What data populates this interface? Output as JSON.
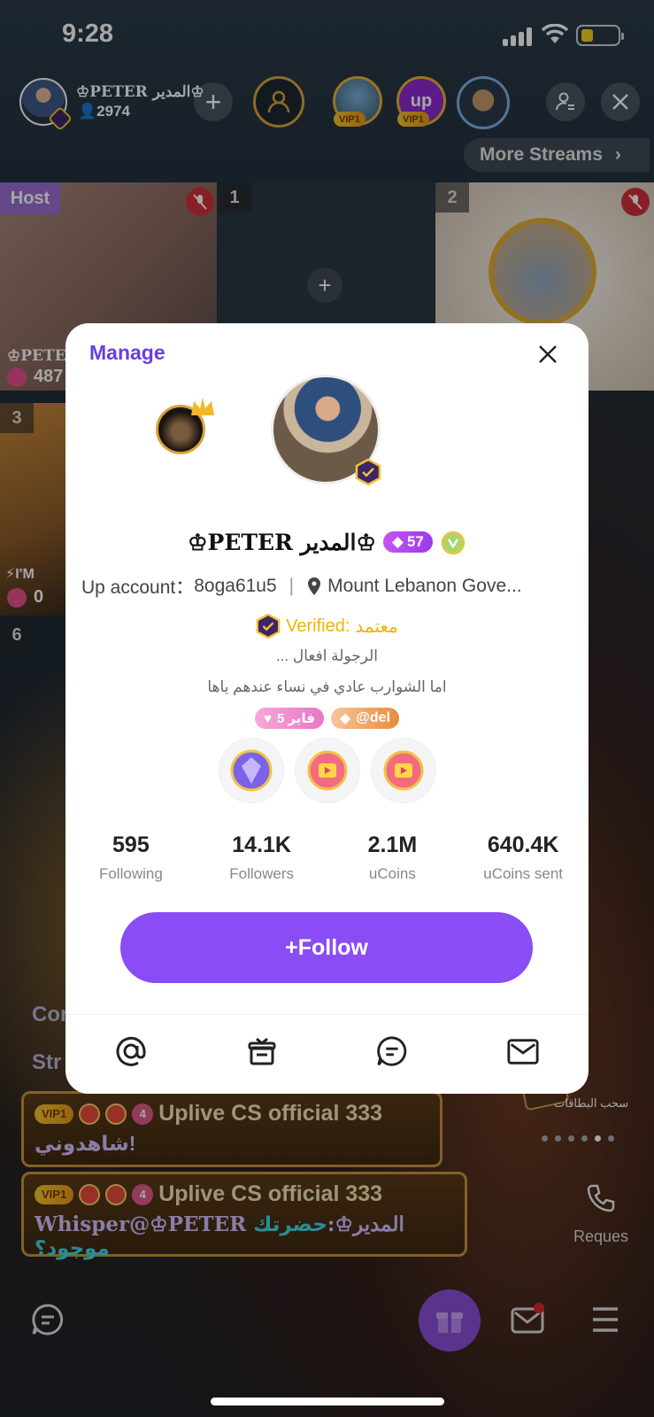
{
  "status_bar": {
    "time": "9:28"
  },
  "top_bar": {
    "host_name": "♔PETER المدير♔",
    "host_count": "2974",
    "add_button": "+",
    "viewers": [
      {
        "badge": "VIP1"
      },
      {
        "badge": "VIP1"
      }
    ],
    "viewer_app_label": "up",
    "more_streams": "More Streams"
  },
  "seats": {
    "host_tag": "Host",
    "seat1": "1",
    "seat2": "2",
    "seat3": "3",
    "seat6": "6",
    "host_partial_name": "♔PETER",
    "host_partial_count": "487",
    "seat3_partial_name": "⚡I'M",
    "seat3_partial_count": "0",
    "add_seat": "+"
  },
  "profile_card": {
    "manage": "Manage",
    "name": "♔PETER المدير♔",
    "level": "57",
    "account_label": "Up account：",
    "account_id": "8oga61u5",
    "location": "Mount Lebanon Gove...",
    "verified_label": "Verified:",
    "verified_value": "معتمد",
    "bio_line1": "الرجولة افعال ...",
    "bio_line2": "اما الشوارب عادي في نساء عندهم ياها",
    "tag_pink": "فاير 5",
    "tag_orange": "@del",
    "stats": [
      {
        "value": "595",
        "label": "Following"
      },
      {
        "value": "14.1K",
        "label": "Followers"
      },
      {
        "value": "2.1M",
        "label": "uCoins"
      },
      {
        "value": "640.4K",
        "label": "uCoins sent"
      }
    ],
    "follow_button": "+Follow"
  },
  "chat": {
    "label1": "Cor",
    "label2": "Str",
    "messages": [
      {
        "vip": "VIP1",
        "level": "4",
        "user": "Uplive CS official 333",
        "text": "!شاهدوني"
      },
      {
        "vip": "VIP1",
        "level": "4",
        "user": "Uplive CS official 333",
        "text_prefix": "Whisper@♔PETER المدير♔:",
        "text_highlight": "حضرتك موجود؟"
      }
    ]
  },
  "side": {
    "card_label": "سحب البطاقات",
    "request_label": "Reques"
  },
  "colors": {
    "accent_purple": "#8a4cf5",
    "manage_purple": "#6a3ce6",
    "verified_gold": "#f0b400",
    "vip_gold": "#f6c92b",
    "mute_red": "#d0303d"
  }
}
